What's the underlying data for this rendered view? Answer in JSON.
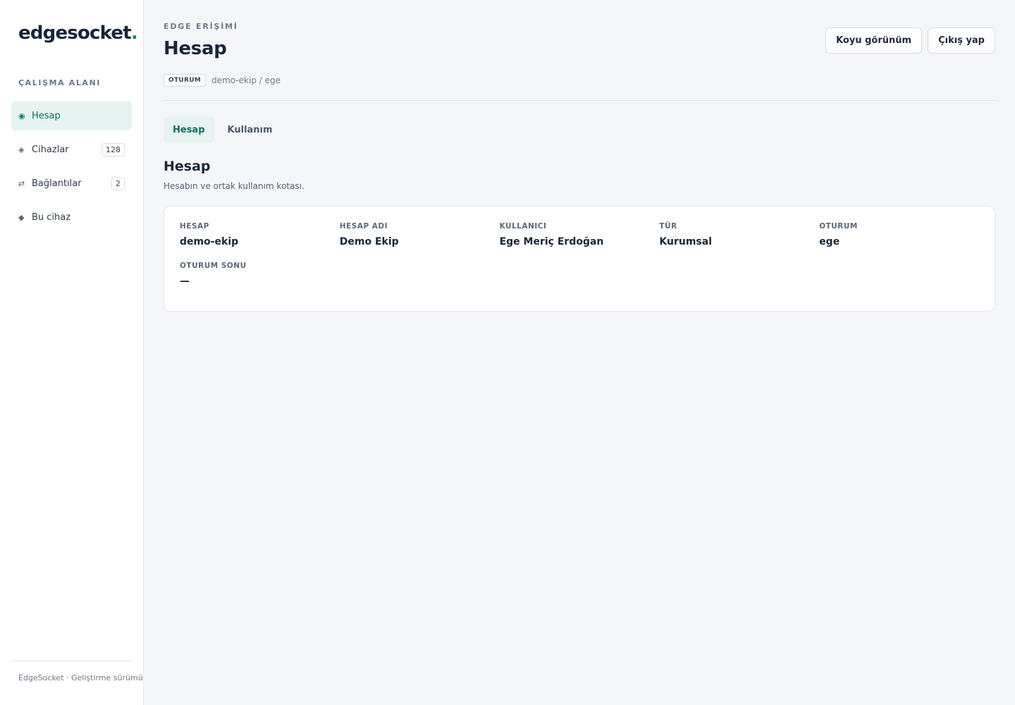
{
  "brand": {
    "name": "edgesocket",
    "dot": "."
  },
  "sidebar": {
    "section_label": "ÇALIŞMA ALANI",
    "items": [
      {
        "icon": "◉",
        "icon_name": "account-icon",
        "label": "Hesap",
        "badge": null,
        "active": true
      },
      {
        "icon": "◈",
        "icon_name": "devices-icon",
        "label": "Cihazlar",
        "badge": "128",
        "active": false
      },
      {
        "icon": "⇄",
        "icon_name": "connections-icon",
        "label": "Bağlantılar",
        "badge": "2",
        "active": false
      },
      {
        "icon": "◆",
        "icon_name": "this-device-icon",
        "label": "Bu cihaz",
        "badge": null,
        "active": false
      }
    ],
    "footer": "EdgeSocket · Geliştirme sürümü"
  },
  "header": {
    "eyebrow": "EDGE ERİŞİMİ",
    "title": "Hesap",
    "dark_mode_label": "Koyu görünüm",
    "logout_label": "Çıkış yap",
    "session_tag": "OTURUM",
    "session_path": "demo-ekip / ege"
  },
  "tabs": [
    {
      "label": "Hesap",
      "active": true
    },
    {
      "label": "Kullanım",
      "active": false
    }
  ],
  "section": {
    "title": "Hesap",
    "subtitle": "Hesabın ve ortak kullanım kotası."
  },
  "account_fields": [
    {
      "label": "HESAP",
      "value": "demo-ekip"
    },
    {
      "label": "HESAP ADI",
      "value": "Demo Ekip"
    },
    {
      "label": "KULLANICI",
      "value": "Ege Meriç Erdoğan"
    },
    {
      "label": "TÜR",
      "value": "Kurumsal"
    },
    {
      "label": "OTURUM",
      "value": "ege"
    },
    {
      "label": "OTURUM SONU",
      "value": "—"
    }
  ],
  "colors": {
    "accent": "#0e6e5c",
    "accent_bg": "#e6f3f0",
    "background": "#f4f6f9"
  }
}
